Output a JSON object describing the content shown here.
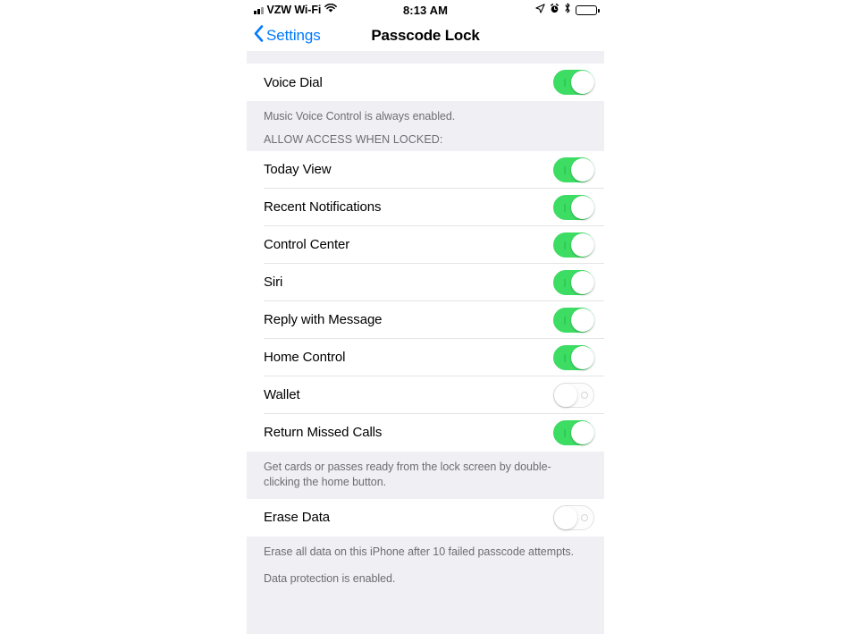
{
  "status_bar": {
    "carrier": "VZW Wi-Fi",
    "time": "8:13 AM",
    "icons": [
      "signal-bars-icon",
      "wifi-icon",
      "location-arrow-icon",
      "alarm-clock-icon",
      "bluetooth-icon",
      "battery-icon"
    ]
  },
  "nav": {
    "back_label": "Settings",
    "title": "Passcode Lock"
  },
  "sections": {
    "voice_dial": {
      "row_label": "Voice Dial",
      "row_state": "on",
      "footer": "Music Voice Control is always enabled."
    },
    "allow_access": {
      "header": "ALLOW ACCESS WHEN LOCKED:",
      "rows": [
        {
          "label": "Today View",
          "state": "on"
        },
        {
          "label": "Recent Notifications",
          "state": "on"
        },
        {
          "label": "Control Center",
          "state": "on"
        },
        {
          "label": "Siri",
          "state": "on"
        },
        {
          "label": "Reply with Message",
          "state": "on"
        },
        {
          "label": "Home Control",
          "state": "on"
        },
        {
          "label": "Wallet",
          "state": "off"
        },
        {
          "label": "Return Missed Calls",
          "state": "on"
        }
      ],
      "footer": "Get cards or passes ready from the lock screen by double-clicking the home button."
    },
    "erase_data": {
      "row_label": "Erase Data",
      "row_state": "off",
      "footer_line1": "Erase all data on this iPhone after 10 failed passcode attempts.",
      "footer_line2": "Data protection is enabled."
    }
  },
  "colors": {
    "accent_blue": "#007aff",
    "switch_on_green": "#3ddc63",
    "group_background": "#efeff4",
    "separator": "#e4e4e6",
    "secondary_text": "#6d6d72"
  }
}
